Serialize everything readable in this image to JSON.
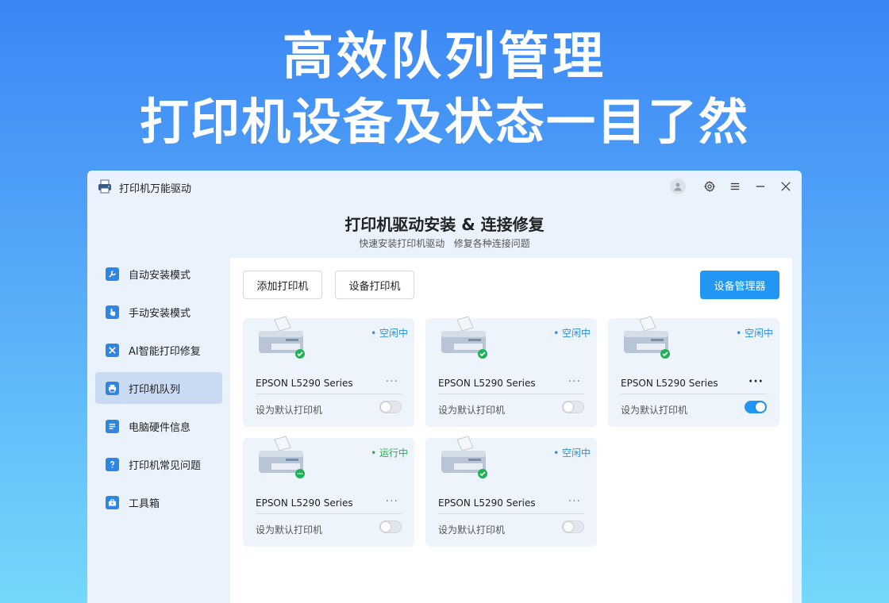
{
  "hero": {
    "line1": "高效队列管理",
    "line2": "打印机设备及状态一目了然"
  },
  "window": {
    "title": "打印机万能驱动",
    "header_title": "打印机驱动安装 & 连接修复",
    "header_subtitle": "快速安装打印机驱动   修复各种连接问题"
  },
  "sidebar": {
    "items": [
      {
        "label": "自动安装模式",
        "icon": "wrench-icon"
      },
      {
        "label": "手动安装模式",
        "icon": "hand-pointer-icon"
      },
      {
        "label": "AI智能打印修复",
        "icon": "tools-icon"
      },
      {
        "label": "打印机队列",
        "icon": "printer-icon"
      },
      {
        "label": "电脑硬件信息",
        "icon": "list-icon"
      },
      {
        "label": "打印机常见问题",
        "icon": "question-icon"
      },
      {
        "label": "工具箱",
        "icon": "toolbox-icon"
      }
    ],
    "active_index": 3
  },
  "toolbar": {
    "add_printer": "添加打印机",
    "device_printer": "设备打印机",
    "device_manager": "设备管理器"
  },
  "printers": [
    {
      "name": "EPSON L5290 Series",
      "status": "空闲中",
      "status_type": "idle",
      "default_label": "设为默认打印机",
      "is_default": false,
      "more": "···"
    },
    {
      "name": "EPSON L5290 Series",
      "status": "空闲中",
      "status_type": "idle",
      "default_label": "设为默认打印机",
      "is_default": false,
      "more": "···"
    },
    {
      "name": "EPSON L5290 Series",
      "status": "空闲中",
      "status_type": "idle",
      "default_label": "设为默认打印机",
      "is_default": true,
      "more": "···"
    },
    {
      "name": "EPSON L5290 Series",
      "status": "运行中",
      "status_type": "running",
      "default_label": "设为默认打印机",
      "is_default": false,
      "more": "···"
    },
    {
      "name": "EPSON L5290 Series",
      "status": "空闲中",
      "status_type": "idle",
      "default_label": "设为默认打印机",
      "is_default": false,
      "more": "···"
    }
  ],
  "colors": {
    "accent": "#2196f3",
    "idle": "#2b8ee8",
    "running": "#22b04a",
    "sidebar_active": "#c9dbf3"
  }
}
